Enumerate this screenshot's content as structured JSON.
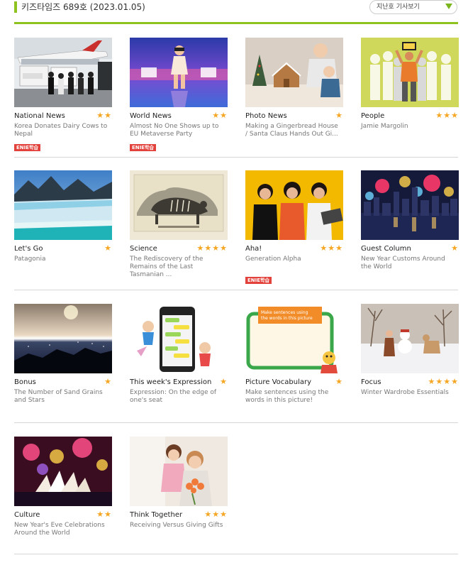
{
  "header": {
    "issue_title": "키즈타임즈 689호 (2023.01.05)",
    "back_issue_select": "지난호 기사보기",
    "accent_color": "#8dc21f",
    "star_color": "#f5a623",
    "badge_color": "#e2423b"
  },
  "articles": [
    {
      "category": "National News",
      "stars": "★★",
      "headline": "Korea Donates Dairy Cows to Nepal",
      "badge": "ENIE학습"
    },
    {
      "category": "World News",
      "stars": "★★",
      "headline": "Almost No One Shows up to EU Metaverse Party",
      "badge": "ENIE학습"
    },
    {
      "category": "Photo News",
      "stars": "★",
      "headline": "Making a Gingerbread House / Santa Claus Hands Out Gi..."
    },
    {
      "category": "People",
      "stars": "★★★",
      "headline": "Jamie Margolin"
    },
    {
      "category": "Let's Go",
      "stars": "★",
      "headline": "Patagonia"
    },
    {
      "category": "Science",
      "stars": "★★★★",
      "headline": "The Rediscovery of the Remains of the Last Tasmanian ..."
    },
    {
      "category": "Aha!",
      "stars": "★★★",
      "headline": "Generation Alpha",
      "badge": "ENIE학습"
    },
    {
      "category": "Guest Column",
      "stars": "★",
      "headline": "New Year Customs Around the World"
    },
    {
      "category": "Bonus",
      "stars": "★",
      "headline": "The Number of Sand Grains and Stars"
    },
    {
      "category": "This week's Expression",
      "stars": "★",
      "headline": "Expression: On the edge of one's seat"
    },
    {
      "category": "Picture Vocabulary",
      "stars": "★",
      "headline": "Make sentences using the words in this picture!",
      "image_text": "Make sentences using the words in this picture"
    },
    {
      "category": "Focus",
      "stars": "★★★★",
      "headline": "Winter Wardrobe Essentials"
    },
    {
      "category": "Culture",
      "stars": "★★",
      "headline": "New Year's Eve Celebrations Around the World"
    },
    {
      "category": "Think Together",
      "stars": "★★★",
      "headline": "Receiving Versus Giving Gifts"
    }
  ]
}
